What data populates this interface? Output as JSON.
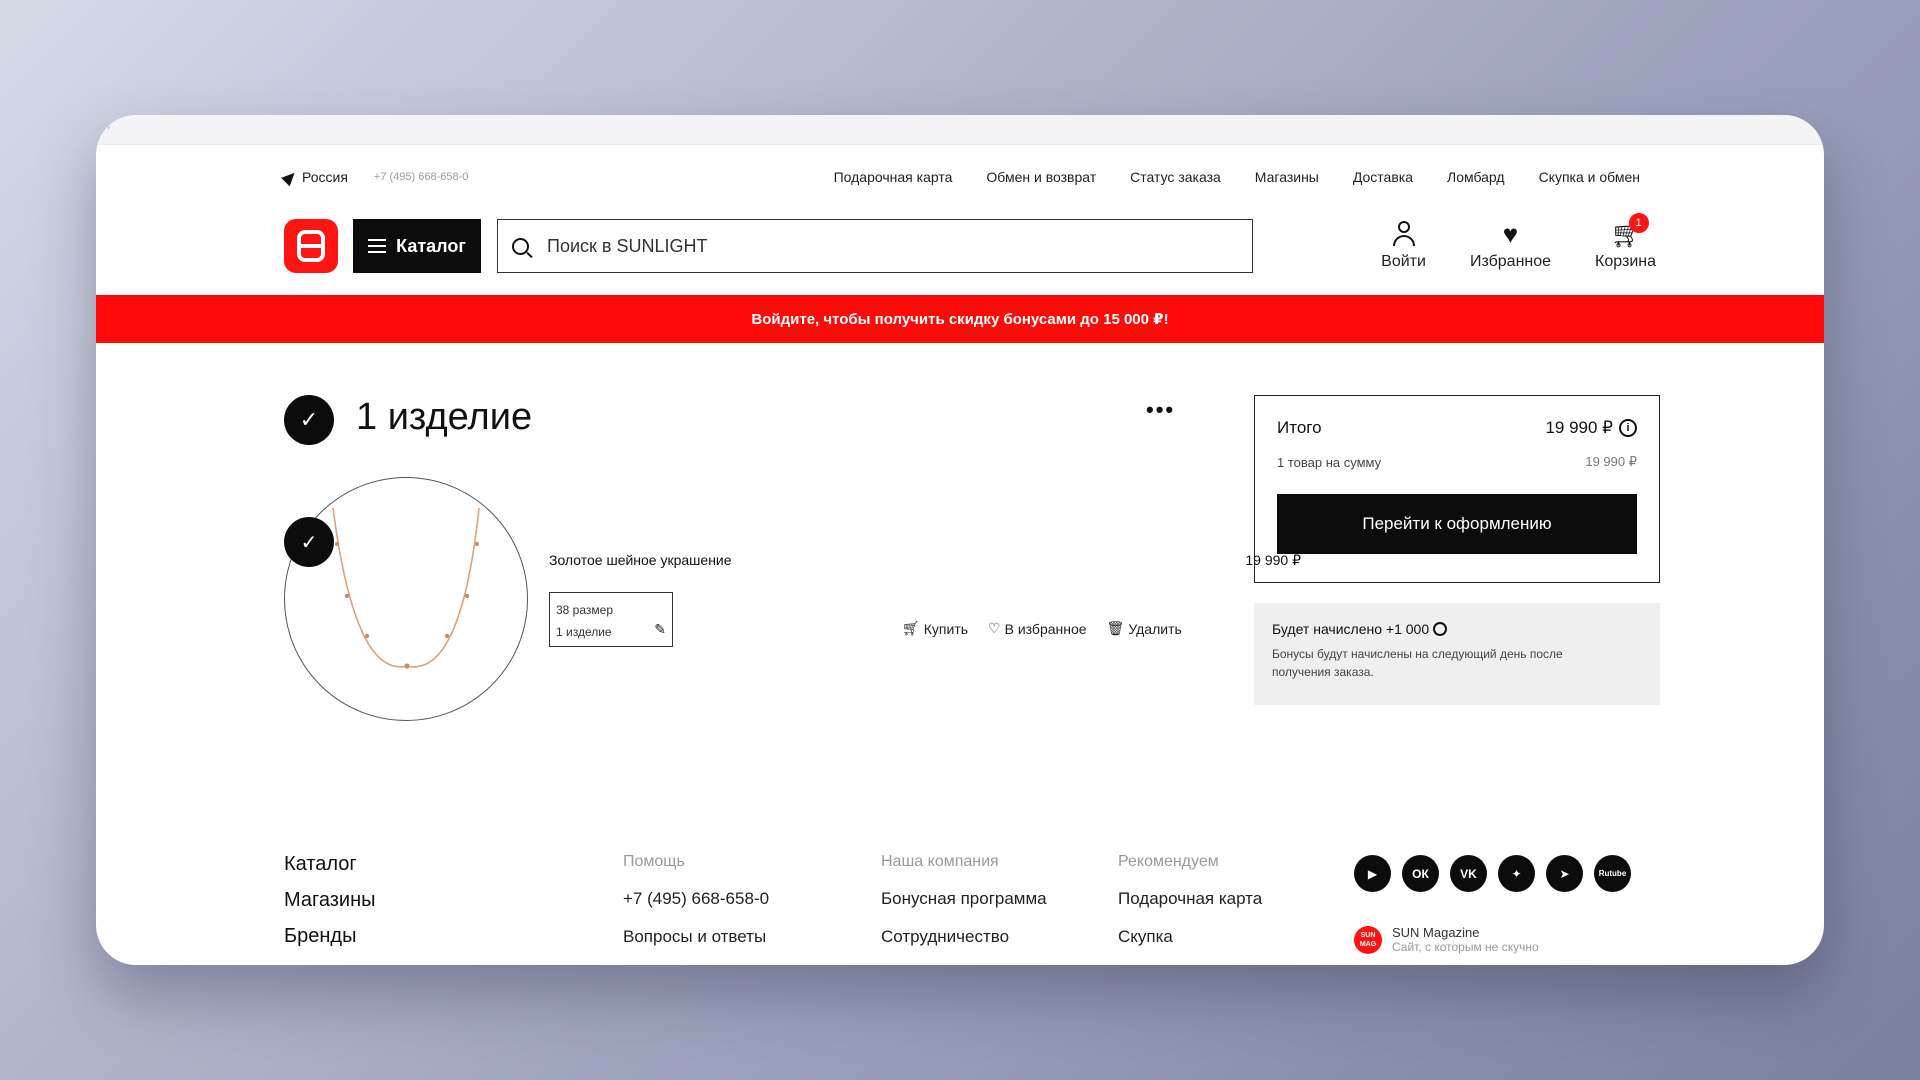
{
  "topbar": {
    "region": "Россия",
    "phone": "+7 (495) 668-658-0",
    "links": [
      "Подарочная карта",
      "Обмен и возврат",
      "Статус заказа",
      "Магазины",
      "Доставка",
      "Ломбард",
      "Скупка и обмен"
    ]
  },
  "header": {
    "catalog_label": "Каталог",
    "search_placeholder": "Поиск в SUNLIGHT",
    "login_label": "Войти",
    "favorites_label": "Избранное",
    "cart_label": "Корзина",
    "cart_count": "1"
  },
  "banner": {
    "text": "Войдите, чтобы получить скидку бонусами до 15 000 ₽!"
  },
  "cart": {
    "title": "1 изделие",
    "more_label": "•••",
    "item": {
      "name": "Золотое шейное украшение",
      "price": "19 990 ₽",
      "size": "38 размер",
      "quantity": "1 изделие"
    },
    "actions": {
      "buy": "Купить",
      "favorite": "В избранное",
      "delete": "Удалить"
    }
  },
  "summary": {
    "title": "Итого",
    "total": "19 990 ₽",
    "subtitle": "1 товар на сумму",
    "subtotal": "19 990 ₽",
    "checkout_label": "Перейти к оформлению",
    "bonus_title": "Будет начислено +1 000",
    "bonus_text": "Бонусы будут начислены на следующий день после получения заказа."
  },
  "footer": {
    "main_links": [
      "Каталог",
      "Магазины",
      "Бренды"
    ],
    "help": {
      "heading": "Помощь",
      "items": [
        "+7 (495) 668-658-0",
        "Вопросы и ответы"
      ]
    },
    "company": {
      "heading": "Наша компания",
      "items": [
        "Бонусная программа",
        "Сотрудничество"
      ]
    },
    "recommend": {
      "heading": "Рекомендуем",
      "items": [
        "Подарочная карта",
        "Скупка"
      ]
    },
    "socials": [
      "youtube-icon",
      "odnoklassniki-icon",
      "vk-icon",
      "dzen-icon",
      "telegram-icon",
      "rutube-icon"
    ],
    "rutube_label": "Rutube",
    "sunmag_mark": "SUN MAG",
    "sunmag_title": "SUN Magazine",
    "sunmag_subtitle": "Сайт, с которым не скучно"
  },
  "colors": {
    "brand_red": "#ff1414",
    "black": "#0c0c0c"
  }
}
